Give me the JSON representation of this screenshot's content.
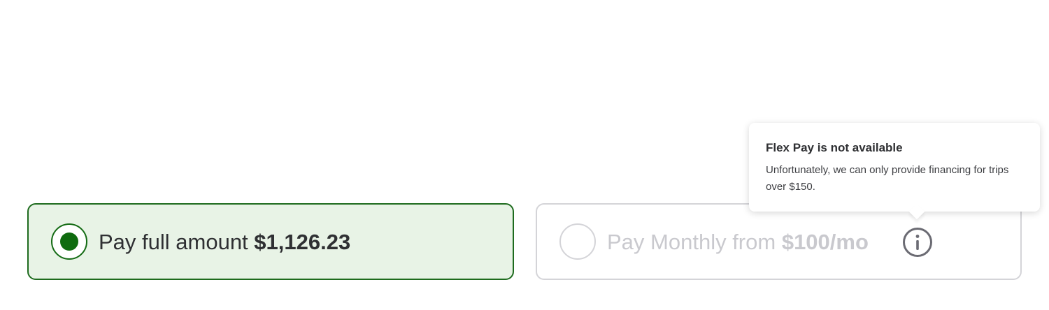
{
  "payment_options": {
    "full": {
      "label": "Pay full amount",
      "price": "$1,126.23",
      "selected": true
    },
    "monthly": {
      "label": "Pay Monthly from",
      "price": "$100/mo",
      "disabled": true,
      "info_icon": "info-icon"
    }
  },
  "tooltip": {
    "title": "Flex Pay is not available",
    "body": "Unfortunately, we can only provide financing for trips over $150."
  },
  "colors": {
    "selected_border": "#1e6b1e",
    "selected_fill": "#e8f3e6",
    "radio_dot": "#0f6b0f",
    "disabled_text": "#c9c9ce",
    "disabled_border": "#d4d4d8",
    "info_icon": "#6b6b73"
  }
}
